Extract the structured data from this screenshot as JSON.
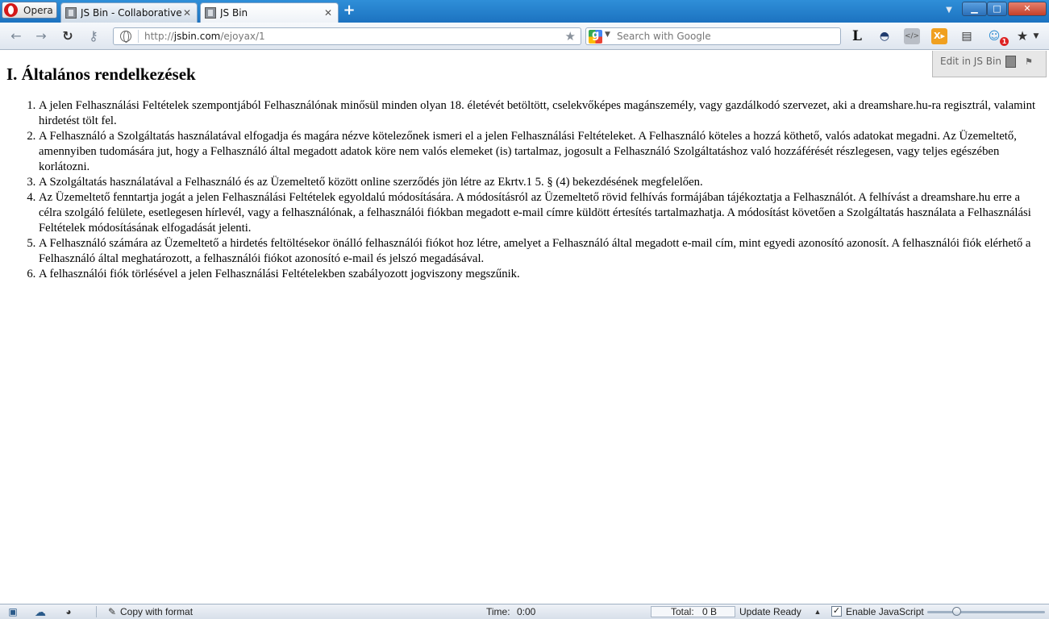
{
  "browser": {
    "menu_label": "Opera",
    "tabs": [
      {
        "title": "JS Bin - Collaborative JavaScript Debugging",
        "active": false
      },
      {
        "title": "JS Bin",
        "active": true
      }
    ],
    "new_tab": "+",
    "window_controls": {
      "minimize": "▁",
      "maximize": "□",
      "close": "✕"
    }
  },
  "toolbar": {
    "url_scheme": "http://",
    "url_host": "jsbin.com",
    "url_path": "/ejoyax/1",
    "search_placeholder": "Search with Google",
    "extension_badge": "1"
  },
  "jsbin": {
    "edit_label": "Edit in JS Bin"
  },
  "page": {
    "heading": "I. Általános rendelkezések",
    "items": [
      "A jelen Felhasználási Feltételek szempontjából Felhasználónak minősül minden olyan 18. életévét betöltött, cselekvőképes magánszemély, vagy gazdálkodó szervezet, aki a dreamshare.hu-ra regisztrál, valamint hirdetést tölt fel.",
      "A Felhasználó a Szolgáltatás használatával elfogadja és magára nézve kötelezőnek ismeri el a jelen Felhasználási Feltételeket. A Felhasználó köteles a hozzá köthető, valós adatokat megadni. Az Üzemeltető, amennyiben tudomására jut, hogy a Felhasználó által megadott adatok köre nem valós elemeket (is) tartalmaz, jogosult a Felhasználó Szolgáltatáshoz való hozzáférését részlegesen, vagy teljes egészében korlátozni.",
      "A Szolgáltatás használatával a Felhasználó és az Üzemeltető között online szerződés jön létre az Ekrtv.1 5. § (4) bekezdésének megfelelően.",
      "Az Üzemeltető fenntartja jogát a jelen Felhasználási Feltételek egyoldalú módosítására. A módosításról az Üzemeltető rövid felhívás formájában tájékoztatja a Felhasználót. A felhívást a dreamshare.hu erre a célra szolgáló felülete, esetlegesen hírlevél, vagy a felhasználónak, a felhasználói fiókban megadott e-mail címre küldött értesítés tartalmazhatja. A módosítást követően a Szolgáltatás használata a Felhasználási Feltételek módosításának elfogadását jelenti.",
      "A Felhasználó számára az Üzemeltető a hirdetés feltöltésekor önálló felhasználói fiókot hoz létre, amelyet a Felhasználó által megadott e-mail cím, mint egyedi azonosító azonosít. A felhasználói fiók elérhető a Felhasználó által meghatározott, a felhasználói fiókot azonosító e-mail és jelszó megadásával.",
      "A felhasználói fiók törlésével a jelen Felhasználási Feltételekben szabályozott jogviszony megszűnik."
    ]
  },
  "statusbar": {
    "copy_label": "Copy with format",
    "time_label": "Time:",
    "time_value": "0:00",
    "total_label": "Total:",
    "total_value": "0 B",
    "update_label": "Update Ready",
    "js_label": "Enable JavaScript",
    "js_checked": true,
    "zoom_fraction": 0.25
  }
}
